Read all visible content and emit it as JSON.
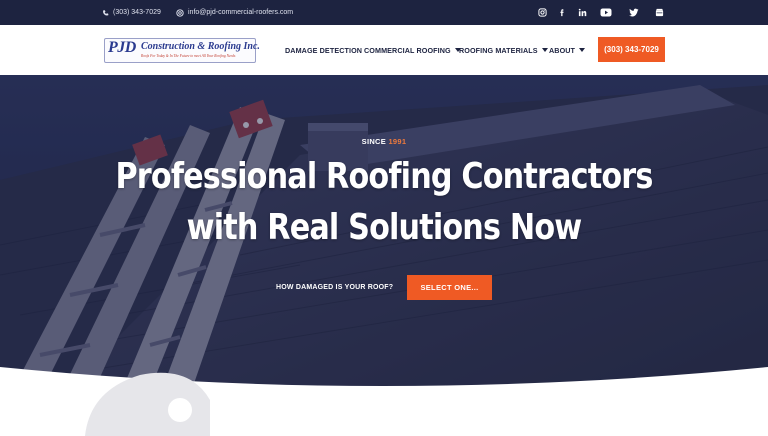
{
  "topbar": {
    "phone": "(303) 343-7029",
    "email": "info@pjd-commercial-roofers.com",
    "social": [
      "instagram-icon",
      "facebook-icon",
      "linkedin-icon",
      "youtube-icon",
      "twitter-icon",
      "google-business-icon"
    ]
  },
  "header": {
    "logo": {
      "initials": "PJD",
      "name": "Construction & Roofing Inc.",
      "tagline": "Roofs For Today & In The Future to meet All Your Roofing Needs"
    },
    "nav": [
      {
        "label": "DAMAGE DETECTION",
        "has_dropdown": false
      },
      {
        "label": "COMMERCIAL ROOFING",
        "has_dropdown": true
      },
      {
        "label": "ROOFING MATERIALS",
        "has_dropdown": true
      },
      {
        "label": "ABOUT",
        "has_dropdown": true
      }
    ],
    "cta_phone": "(303) 343-7029"
  },
  "hero": {
    "since_label": "SINCE",
    "since_year": "1991",
    "headline_line1": "Professional Roofing Contractors",
    "headline_line2": "with Real Solutions Now",
    "question": "HOW DAMAGED IS YOUR ROOF?",
    "select_label": "SELECT ONE..."
  },
  "colors": {
    "navy": "#1d2340",
    "accent_orange": "#ef5a24",
    "white": "#ffffff"
  }
}
